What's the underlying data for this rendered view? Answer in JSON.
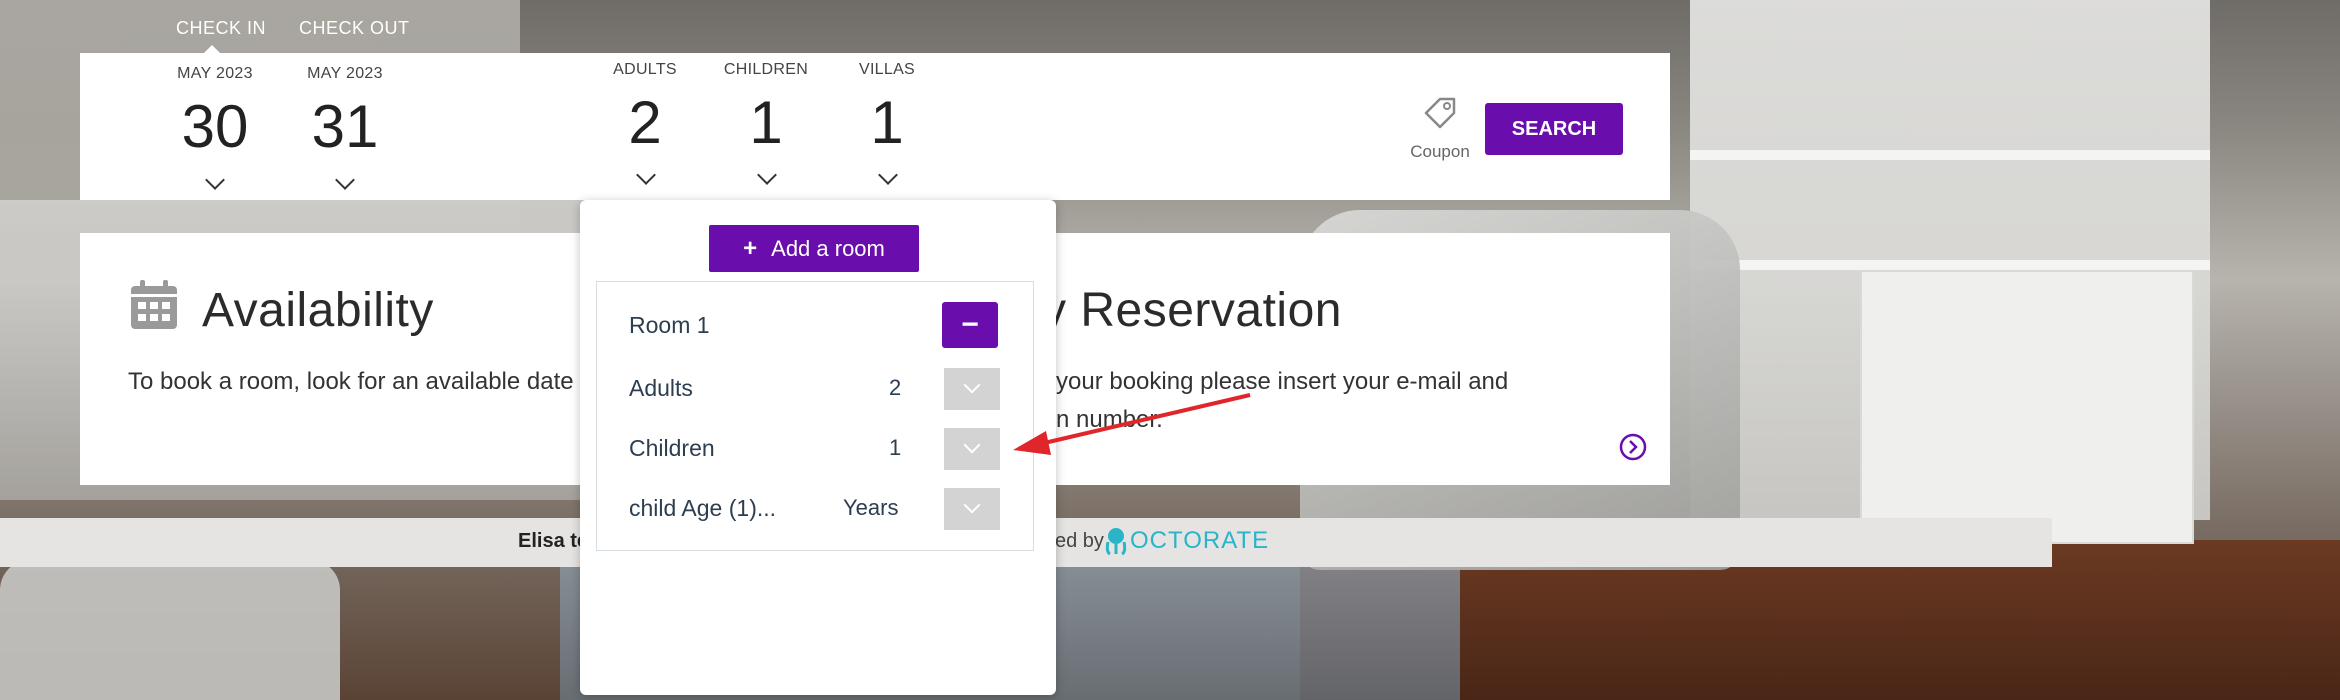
{
  "tabs": {
    "check_in": "CHECK IN",
    "check_out": "CHECK OUT"
  },
  "dates": {
    "checkin": {
      "month": "MAY 2023",
      "day": "30"
    },
    "checkout": {
      "month": "MAY 2023",
      "day": "31"
    }
  },
  "guests": {
    "adults": {
      "label": "ADULTS",
      "value": "2"
    },
    "children": {
      "label": "CHILDREN",
      "value": "1"
    },
    "villas": {
      "label": "VILLAS",
      "value": "1"
    }
  },
  "coupon_label": "Coupon",
  "search_label": "SEARCH",
  "availability": {
    "title": "Availability",
    "text": "To book a room, look for an available date"
  },
  "reservation": {
    "title": "y Reservation",
    "text1": "your booking please insert your e-mail and",
    "text2": "n number."
  },
  "footer": {
    "left": "Elisa te",
    "powered": "ed by",
    "brand": "OCTORATE"
  },
  "panel": {
    "add_room_label": "Add a room",
    "room_title": "Room 1",
    "minus_label": "−",
    "rows": {
      "adults": {
        "label": "Adults",
        "value": "2"
      },
      "children": {
        "label": "Children",
        "value": "1"
      },
      "child_age": {
        "label": "child Age (1)...",
        "value": "Years"
      }
    }
  },
  "colors": {
    "accent": "#6a0dad",
    "annotation": "#e0262a",
    "brand": "#2ab4c8"
  },
  "icons": {
    "calendar": "calendar-icon",
    "coupon": "tag-icon",
    "next": "circle-chevron-right-icon"
  }
}
